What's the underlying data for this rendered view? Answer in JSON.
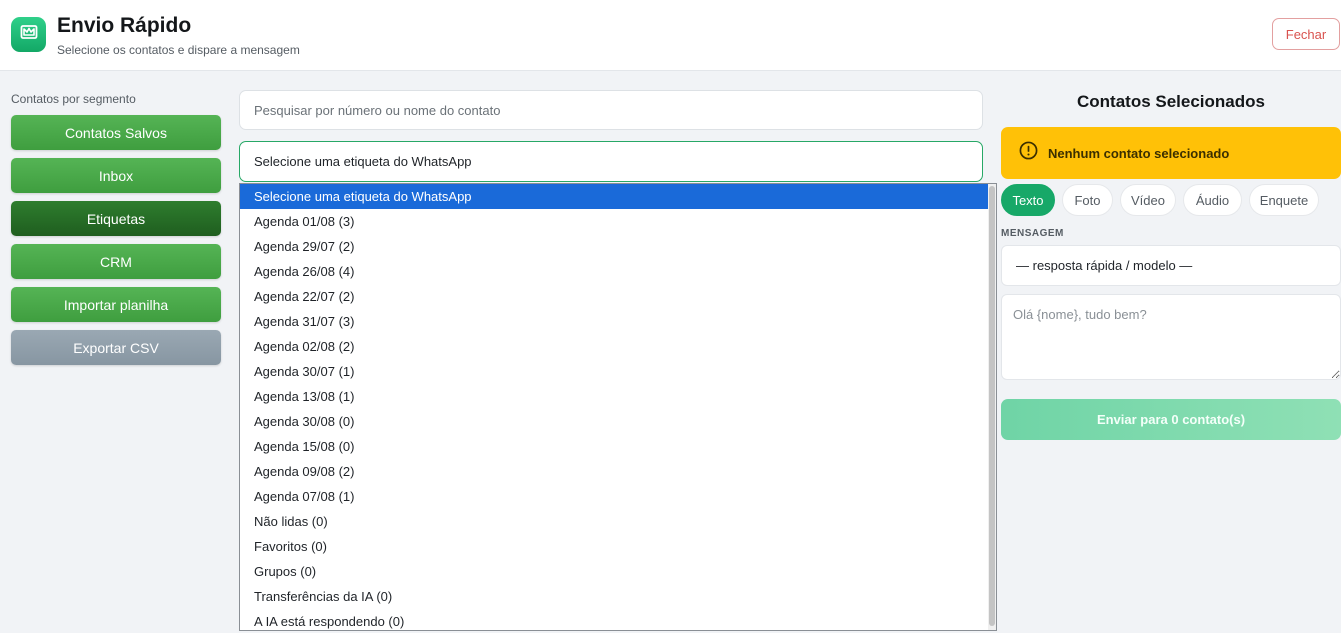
{
  "header": {
    "title": "Envio Rápido",
    "subtitle": "Selecione os contatos e dispare a mensagem",
    "close_label": "Fechar",
    "logo_icon": "crown-icon"
  },
  "segments": {
    "label": "Contatos por segmento",
    "items": [
      {
        "label": "Contatos Salvos"
      },
      {
        "label": "Inbox"
      },
      {
        "label": "Etiquetas"
      },
      {
        "label": "CRM"
      },
      {
        "label": "Importar planilha"
      },
      {
        "label": "Exportar CSV"
      }
    ],
    "active": "Etiquetas"
  },
  "search": {
    "placeholder": "Pesquisar por número ou nome do contato",
    "value": ""
  },
  "label_select": {
    "selected": "Selecione uma etiqueta do WhatsApp",
    "options": [
      "Selecione uma etiqueta do WhatsApp",
      "Agenda 01/08 (3)",
      "Agenda 29/07 (2)",
      "Agenda 26/08 (4)",
      "Agenda 22/07 (2)",
      "Agenda 31/07 (3)",
      "Agenda 02/08 (2)",
      "Agenda 30/07 (1)",
      "Agenda 13/08 (1)",
      "Agenda 30/08 (0)",
      "Agenda 15/08 (0)",
      "Agenda 09/08 (2)",
      "Agenda 07/08 (1)",
      "Não lidas (0)",
      "Favoritos (0)",
      "Grupos (0)",
      "Transferências da IA (0)",
      "A IA está respondendo (0)"
    ]
  },
  "selected_panel": {
    "title": "Contatos Selecionados",
    "alert": "Nenhum contato selecionado",
    "alert_color": "#ffc107"
  },
  "tabs": {
    "items": [
      "Texto",
      "Foto",
      "Vídeo",
      "Áudio",
      "Enquete"
    ],
    "active": "Texto"
  },
  "message": {
    "label": "MENSAGEM",
    "template_selected": "— resposta rápida / modelo —",
    "placeholder": "Olá {nome}, tudo bem?",
    "value": "",
    "send_label": "Enviar para 0 contato(s)"
  },
  "colors": {
    "accent": "#17a868",
    "segment_green": "#4caf50",
    "segment_active": "#2e7d2e",
    "dropdown_highlight": "#1a6ad9"
  }
}
